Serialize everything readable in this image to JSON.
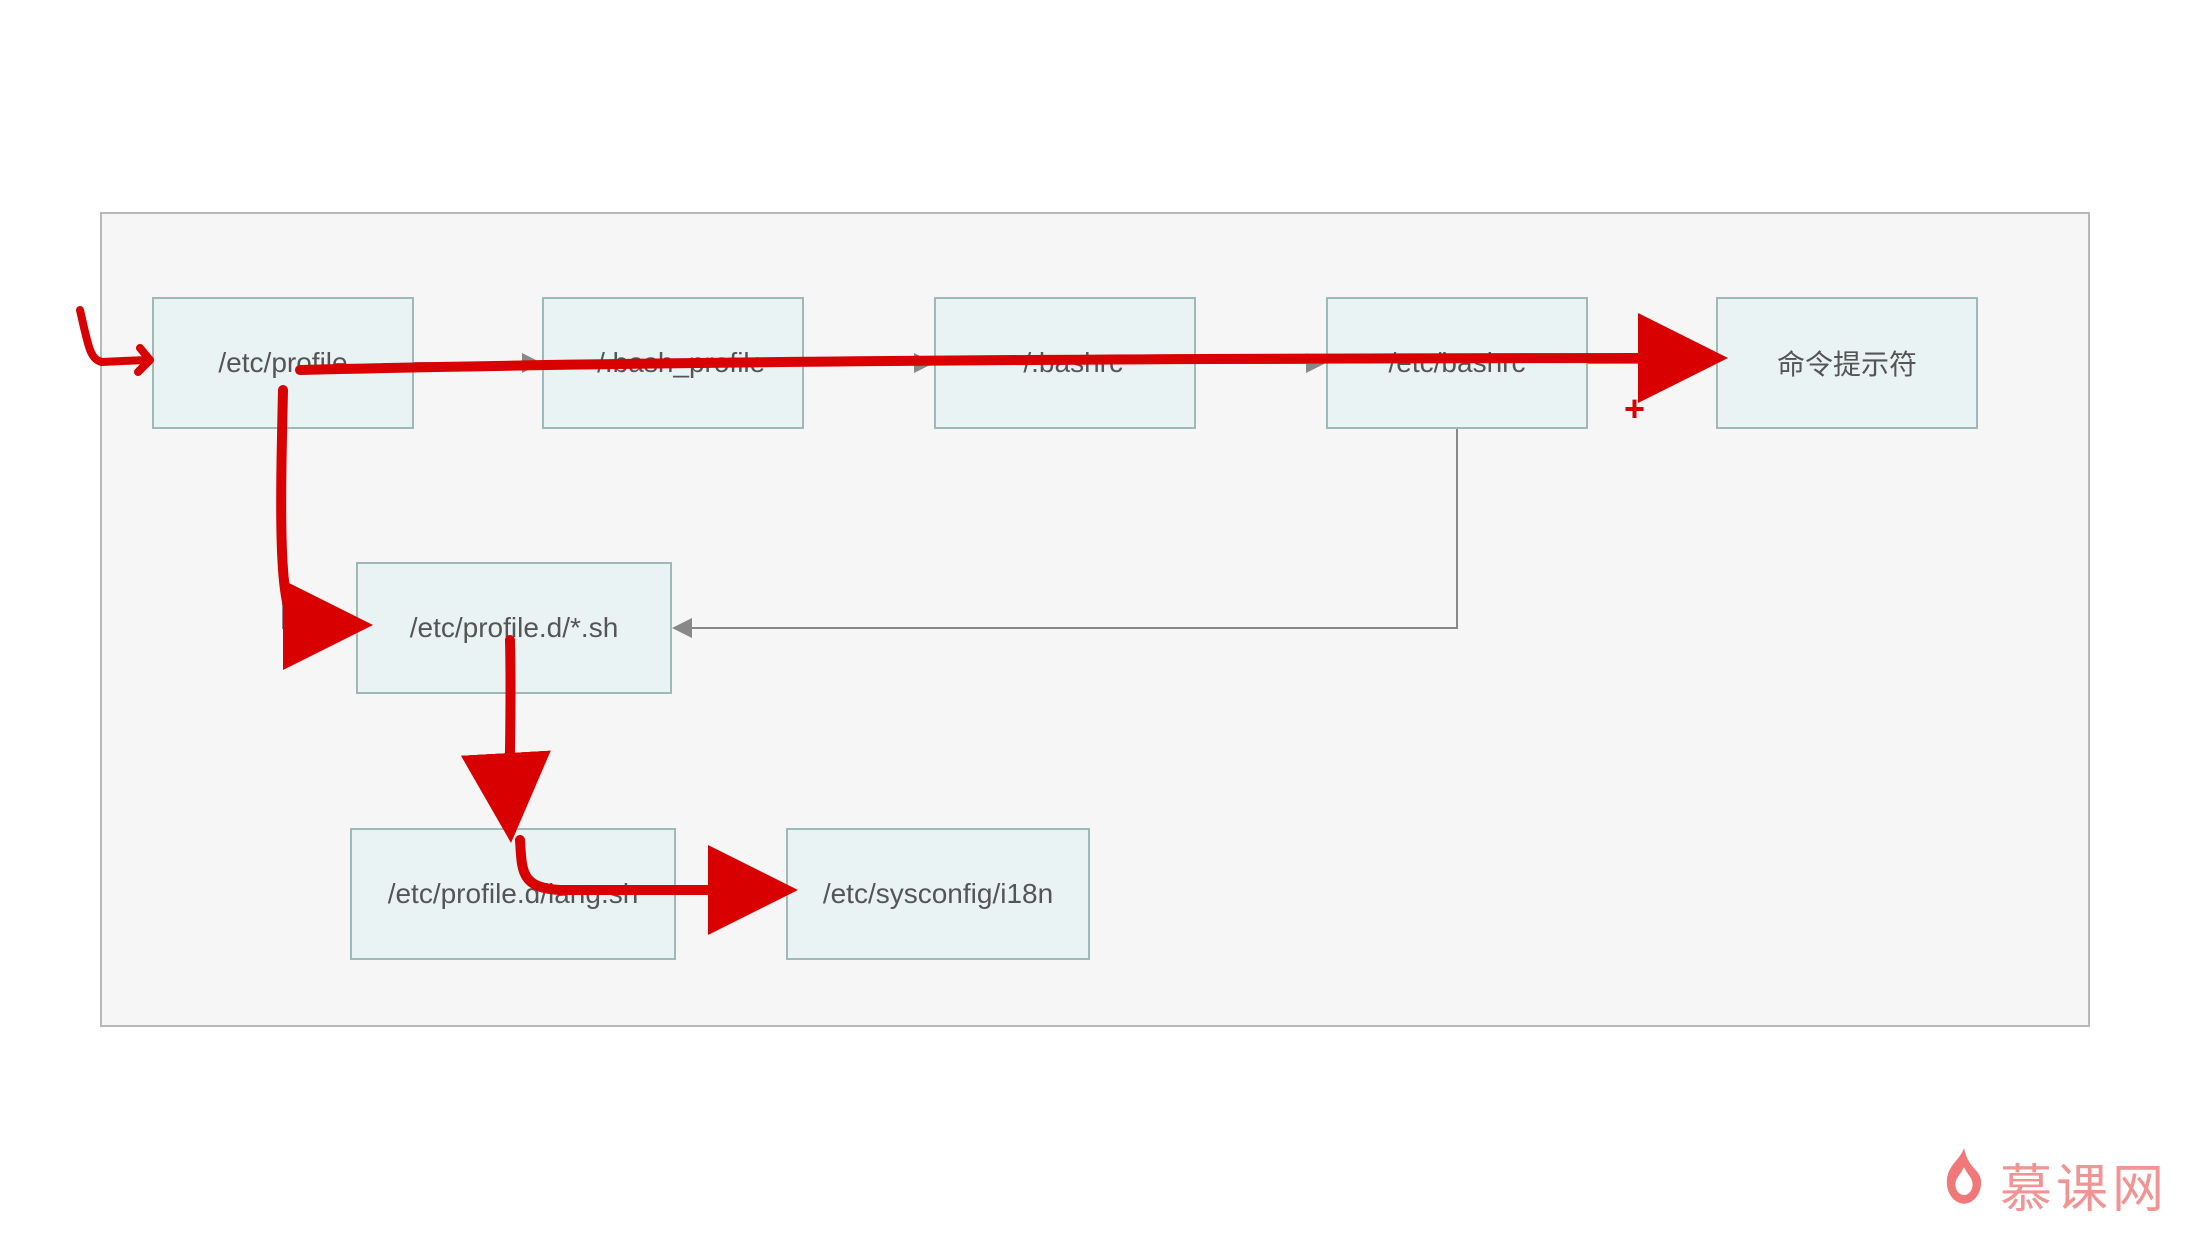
{
  "diagram": {
    "nodes": {
      "n1": "/etc/profile",
      "n2": "~/.bash_profile",
      "n3": "~/.bashrc",
      "n4": "/etc/bashrc",
      "n5": "命令提示符",
      "n6": "/etc/profile.d/*.sh",
      "n7": "/etc/profile.d/lang.sh",
      "n8": "/etc/sysconfig/i18n"
    },
    "annotations": {
      "plus": "+"
    }
  },
  "watermark": {
    "text": "慕课网"
  }
}
